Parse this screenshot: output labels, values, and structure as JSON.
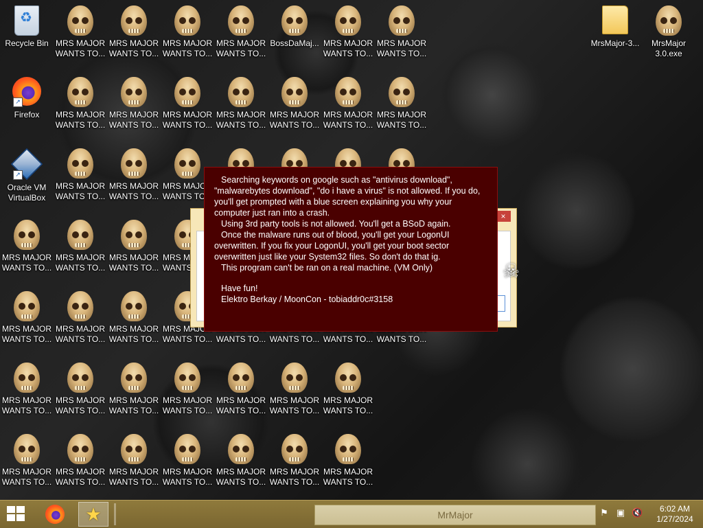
{
  "desktop": {
    "left_icons": [
      {
        "label": "Recycle Bin",
        "icon": "recycle-bin-icon"
      },
      {
        "label": "Firefox",
        "icon": "firefox-icon"
      },
      {
        "label": "Oracle VM VirtualBox",
        "icon": "virtualbox-icon"
      }
    ],
    "skull_label": "MRS MAJOR WANTS TO...",
    "boss_label": "BossDaMaj...",
    "right_icons": [
      {
        "label": "MrsMajor-3...",
        "icon": "folder-icon"
      },
      {
        "label": "MrsMajor 3.0.exe",
        "icon": "skull-icon"
      }
    ]
  },
  "message": {
    "paragraphs": [
      "Searching keywords on google such as \"antivirus download\", \"malwarebytes download\", \"do i have a virus\" is not allowed. If you do, you'll get prompted with a blue screen explaining you why your computer just ran into a crash.",
      "Using 3rd party tools is not allowed. You'll get a BSoD again.",
      "Once the malware runs out of blood, you'll get your LogonUI overwritten. If you fix your LogonUI, you'll get your boot sector overwritten just like your System32 files. So don't do that ig.",
      "This program can't be ran on a real machine. (VM Only)"
    ],
    "closing": "Have fun!",
    "signature": "Elektro Berkay / MoonCon - tobiaddr0c#3158"
  },
  "background_window": {
    "close_glyph": "×"
  },
  "taskbar": {
    "window_title": "MrMajor",
    "time": "6:02 AM",
    "date": "1/27/2024",
    "tray_icons": [
      "flag-alert-icon",
      "network-icon",
      "volume-muted-icon"
    ]
  },
  "colors": {
    "message_bg": "#4a0000",
    "taskbar_bg": "#8f7a3c"
  }
}
